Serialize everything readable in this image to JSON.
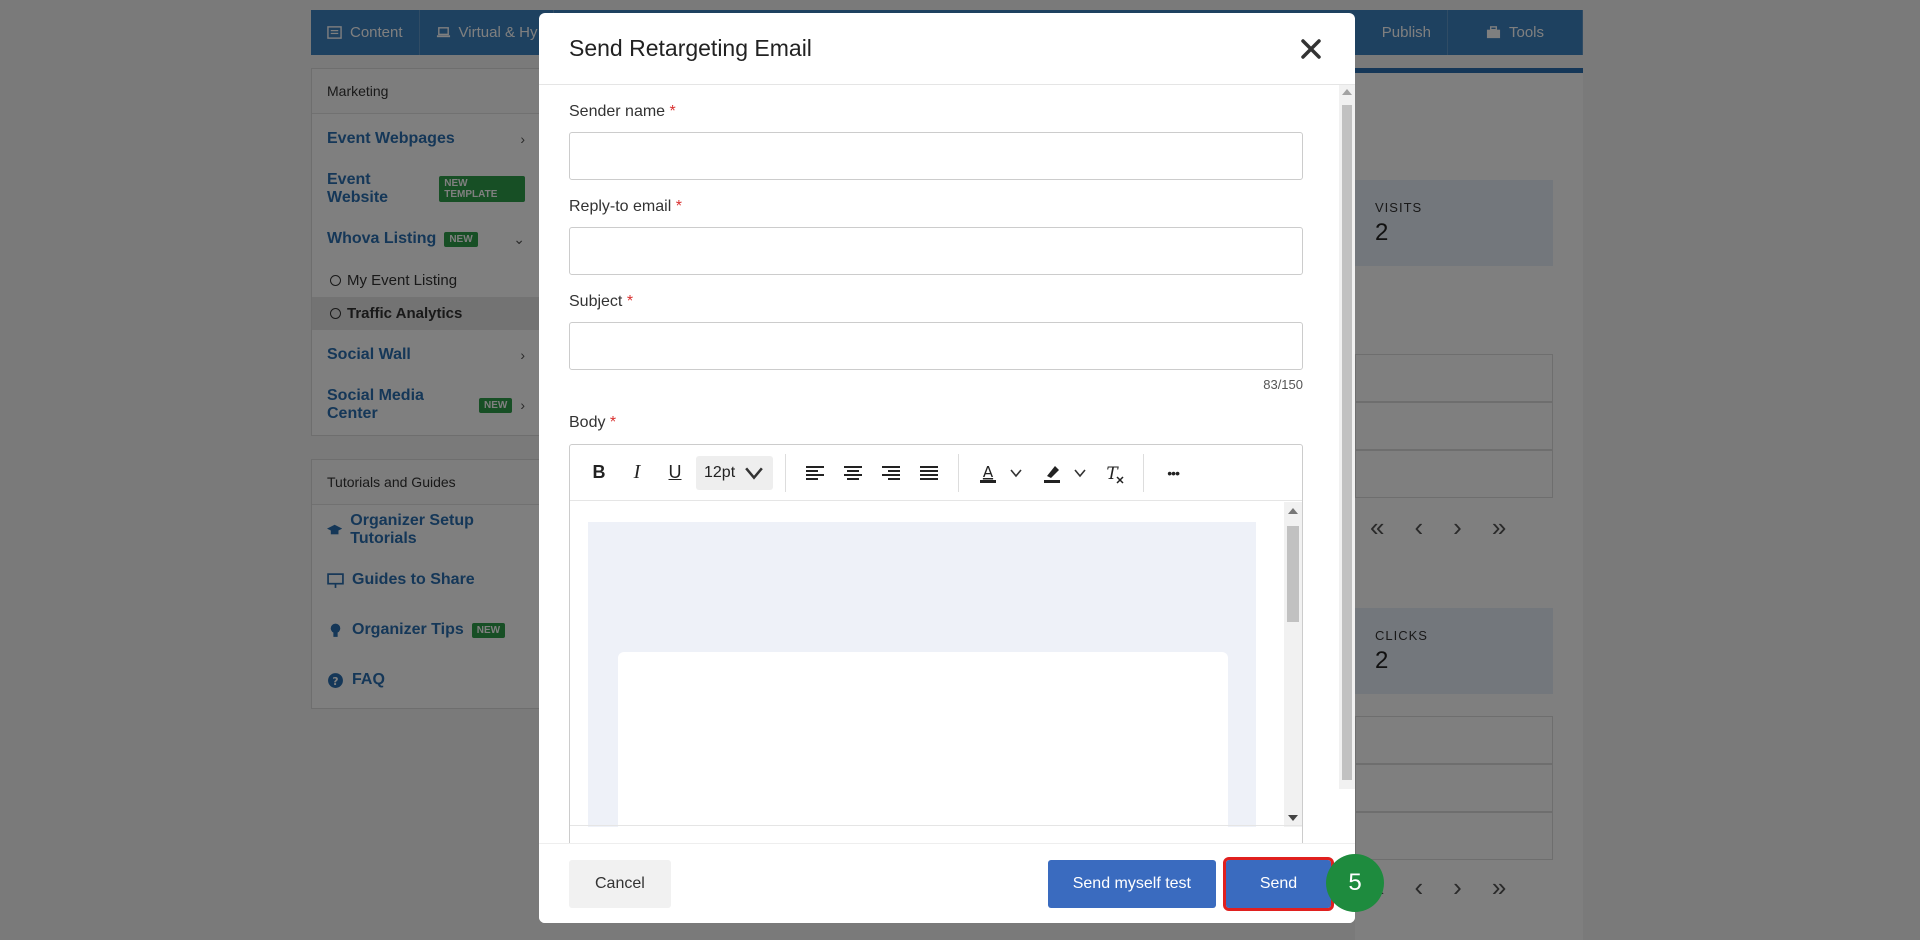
{
  "topnav": {
    "tabs": [
      {
        "label": "Content",
        "icon": "list-icon"
      },
      {
        "label": "Virtual & Hy",
        "icon": "laptop-icon"
      }
    ],
    "right_tabs": [
      {
        "label": "Publish",
        "icon": "none"
      },
      {
        "label": "Tools",
        "icon": "briefcase-icon"
      }
    ]
  },
  "sidebar": {
    "marketing_header": "Marketing",
    "items": [
      {
        "label": "Event Webpages"
      },
      {
        "label": "Event Website",
        "badge": "NEW TEMPLATE"
      },
      {
        "label": "Whova Listing",
        "badge": "NEW"
      },
      {
        "label": "Social Wall"
      },
      {
        "label": "Social Media Center",
        "badge": "NEW"
      }
    ],
    "sub_items": [
      "My Event Listing",
      "Traffic Analytics"
    ],
    "tutorials_header": "Tutorials and Guides",
    "tutorials": [
      {
        "label": "Organizer Setup Tutorials",
        "icon": "graduation-cap-icon"
      },
      {
        "label": "Guides to Share",
        "icon": "presentation-icon"
      },
      {
        "label": "Organizer Tips",
        "icon": "lightbulb-icon",
        "badge": "NEW"
      },
      {
        "label": "FAQ",
        "icon": "question-circle-icon"
      }
    ]
  },
  "stats": {
    "visits_label": "VISITS",
    "visits_value": "2",
    "clicks_label": "CLICKS",
    "clicks_value": "2"
  },
  "modal": {
    "title": "Send Retargeting Email",
    "fields": {
      "sender_name": {
        "label": "Sender name",
        "required": "*",
        "value": ""
      },
      "reply_to": {
        "label": "Reply-to email",
        "required": "*",
        "value": ""
      },
      "subject": {
        "label": "Subject",
        "required": "*",
        "value": "",
        "counter": "83/150"
      },
      "body": {
        "label": "Body",
        "required": "*"
      }
    },
    "toolbar": {
      "bold": "B",
      "italic": "I",
      "underline": "U",
      "font_size": "12pt",
      "more": "•••"
    },
    "footer": {
      "cancel_label": "Cancel",
      "test_label": "Send myself test",
      "send_label": "Send"
    }
  },
  "step_badge": "5",
  "colors": {
    "primary": "#3a6bbf",
    "nav": "#3d82c0",
    "highlight": "#e0201f",
    "step": "#1e8b3e",
    "badge": "#2e9e4a"
  }
}
